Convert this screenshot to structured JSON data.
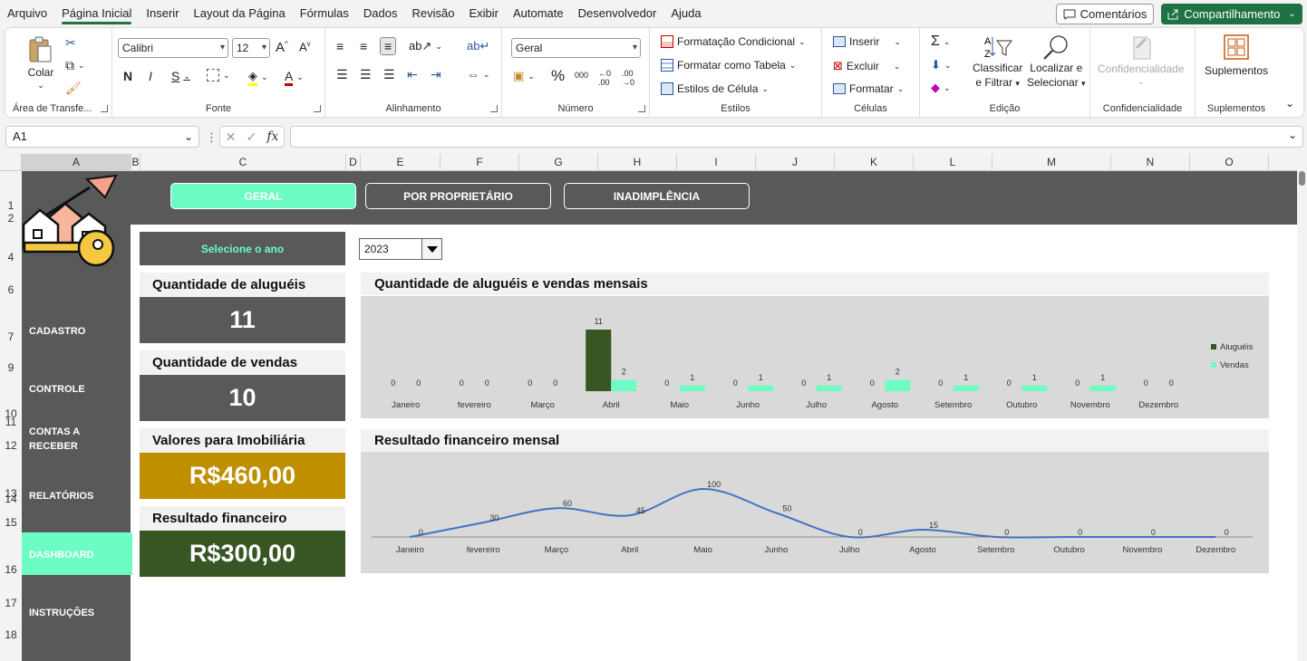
{
  "menu": {
    "tabs": [
      "Arquivo",
      "Página Inicial",
      "Inserir",
      "Layout da Página",
      "Fórmulas",
      "Dados",
      "Revisão",
      "Exibir",
      "Automate",
      "Desenvolvedor",
      "Ajuda"
    ],
    "active_tab": "Página Inicial",
    "comments_label": "Comentários",
    "share_label": "Compartilhamento"
  },
  "ribbon": {
    "clipboard": {
      "paste_label": "Colar",
      "group_label": "Área de Transfe..."
    },
    "font": {
      "family": "Calibri",
      "size": "12",
      "bold": "N",
      "italic": "I",
      "underline": "S",
      "group_label": "Fonte"
    },
    "alignment": {
      "group_label": "Alinhamento"
    },
    "number": {
      "format": "Geral",
      "group_label": "Número"
    },
    "styles": {
      "conditional_label": "Formatação Condicional",
      "table_label": "Formatar como Tabela",
      "cell_styles_label": "Estilos de Célula",
      "group_label": "Estilos"
    },
    "cells": {
      "insert_label": "Inserir",
      "delete_label": "Excluir",
      "format_label": "Formatar",
      "group_label": "Células"
    },
    "editing": {
      "sort_label_1": "Classificar",
      "sort_label_2": "e Filtrar",
      "find_label_1": "Localizar e",
      "find_label_2": "Selecionar",
      "group_label": "Edição"
    },
    "sensitivity": {
      "label": "Confidencialidade",
      "group_label": "Confidencialidade"
    },
    "addins": {
      "label": "Suplementos",
      "group_label": "Suplementos"
    }
  },
  "formula_bar": {
    "name_box": "A1",
    "formula": ""
  },
  "columns": [
    "A",
    "B",
    "C",
    "D",
    "E",
    "F",
    "G",
    "H",
    "I",
    "J",
    "K",
    "L",
    "M",
    "N",
    "O"
  ],
  "rows": [
    "1",
    "2",
    "4",
    "6",
    "7",
    "9",
    "10",
    "11",
    "12",
    "13",
    "14",
    "15",
    "16",
    "17",
    "18"
  ],
  "dashboard": {
    "nav_tabs": [
      "GERAL",
      "POR PROPRIETÁRIO",
      "INADIMPLÊNCIA"
    ],
    "sidebar": [
      "CADASTRO",
      "CONTROLE",
      "CONTAS A RECEBER",
      "RELATÓRIOS",
      "DASHBOARD",
      "INSTRUÇÕES"
    ],
    "year_label": "Selecione o ano",
    "year_value": "2023",
    "kpis": [
      {
        "title": "Quantidade de aluguéis",
        "value": "11",
        "color": "#595959"
      },
      {
        "title": "Quantidade de vendas",
        "value": "10",
        "color": "#595959"
      },
      {
        "title": "Valores para Imobiliária",
        "value": "R$460,00",
        "color": "#bf8f00"
      },
      {
        "title": "Resultado financeiro",
        "value": "R$300,00",
        "color": "#375623"
      }
    ]
  },
  "chart_data": [
    {
      "type": "bar",
      "title": "Quantidade de aluguéis e vendas mensais",
      "categories": [
        "Janeiro",
        "fevereiro",
        "Março",
        "Abril",
        "Maio",
        "Junho",
        "Julho",
        "Agosto",
        "Setembro",
        "Outubro",
        "Novembro",
        "Dezembro"
      ],
      "series": [
        {
          "name": "Aluguéis",
          "color": "#375623",
          "values": [
            0,
            0,
            0,
            11,
            0,
            0,
            0,
            0,
            0,
            0,
            0,
            0
          ]
        },
        {
          "name": "Vendas",
          "color": "#6dfcc4",
          "values": [
            0,
            0,
            0,
            2,
            1,
            1,
            1,
            2,
            1,
            1,
            1,
            0
          ]
        }
      ],
      "legend": "right",
      "grid": false
    },
    {
      "type": "line",
      "title": "Resultado financeiro mensal",
      "categories": [
        "Janeiro",
        "fevereiro",
        "Março",
        "Abril",
        "Maio",
        "Junho",
        "Julho",
        "Agosto",
        "Setembro",
        "Outubro",
        "Novembro",
        "Dezembro"
      ],
      "series": [
        {
          "color": "#4472c4",
          "values": [
            0,
            30,
            60,
            45,
            100,
            50,
            0,
            15,
            0,
            0,
            0,
            0
          ]
        }
      ],
      "smooth": true,
      "grid": false
    }
  ]
}
